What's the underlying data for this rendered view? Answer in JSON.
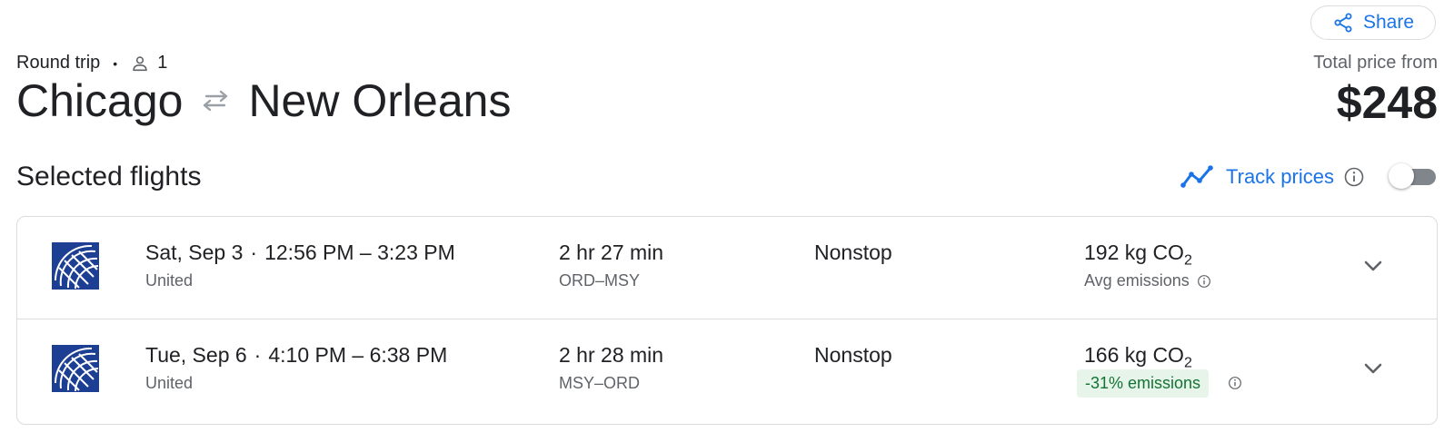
{
  "header": {
    "share_label": "Share",
    "trip_type": "Round trip",
    "passengers": "1",
    "origin": "Chicago",
    "destination": "New Orleans",
    "price_label": "Total price from",
    "price": "$248"
  },
  "selected": {
    "title": "Selected flights",
    "track_label": "Track prices",
    "track_enabled": false
  },
  "flights": [
    {
      "date": "Sat, Sep 3",
      "time_range": "12:56 PM – 3:23 PM",
      "airline": "United",
      "duration": "2 hr 27 min",
      "airports": "ORD–MSY",
      "stops": "Nonstop",
      "emissions_value": "192 kg CO",
      "emissions_sub": "2",
      "emissions_note": "Avg emissions"
    },
    {
      "date": "Tue, Sep 6",
      "time_range": "4:10 PM – 6:38 PM",
      "airline": "United",
      "duration": "2 hr 28 min",
      "airports": "MSY–ORD",
      "stops": "Nonstop",
      "emissions_value": "166 kg CO",
      "emissions_sub": "2",
      "emissions_badge": "-31% emissions"
    }
  ],
  "colors": {
    "accent": "#1a73e8",
    "united_blue": "#1c3f94",
    "badge_bg": "#e6f4ea",
    "badge_text": "#137333"
  },
  "icons": [
    "share-icon",
    "person-icon",
    "swap-arrows-icon",
    "trend-icon",
    "info-icon",
    "chevron-down-icon",
    "united-logo"
  ]
}
